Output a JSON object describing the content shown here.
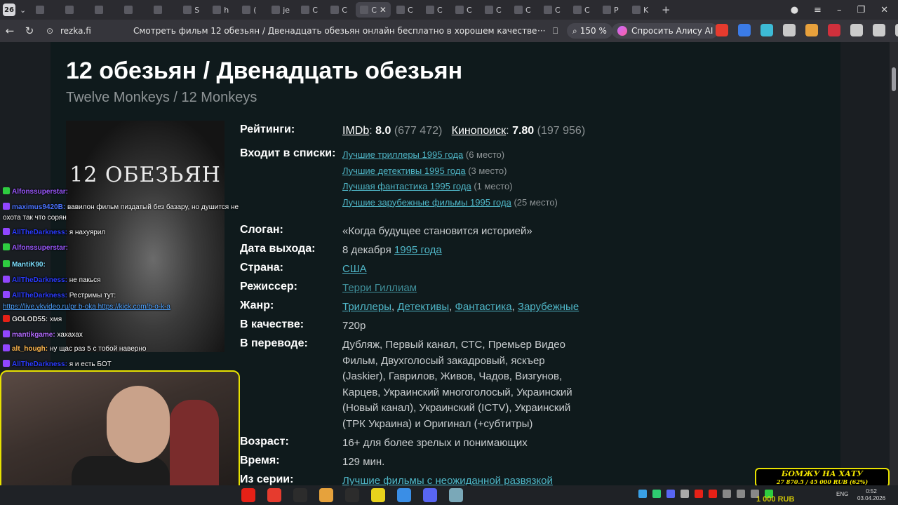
{
  "browser": {
    "tab_count": "26",
    "tabs": [
      {
        "label": "",
        "icon": "youtube-icon"
      },
      {
        "label": "",
        "icon": "gmail-icon"
      },
      {
        "label": "",
        "icon": "home-icon"
      },
      {
        "label": "",
        "icon": "hd-icon"
      },
      {
        "label": "",
        "icon": "hd-icon"
      },
      {
        "label": "S",
        "icon": "steam-icon"
      },
      {
        "label": "h",
        "icon": "news-icon"
      },
      {
        "label": "(",
        "icon": "chat-icon"
      },
      {
        "label": "je",
        "icon": "doc-icon"
      },
      {
        "label": "C",
        "icon": "hd-icon"
      },
      {
        "label": "C",
        "icon": "hd-icon"
      },
      {
        "label": "C",
        "icon": "hd-icon"
      },
      {
        "label": "C",
        "icon": "hd-icon"
      },
      {
        "label": "C",
        "icon": "hd-icon"
      },
      {
        "label": "C",
        "icon": "hd-icon"
      },
      {
        "label": "C",
        "icon": "hd-icon"
      },
      {
        "label": "C",
        "icon": "hd-icon"
      },
      {
        "label": "C",
        "icon": "hd-icon"
      },
      {
        "label": "C",
        "icon": "hd-icon"
      },
      {
        "label": "P",
        "icon": "app-icon"
      },
      {
        "label": "K",
        "icon": "twitch-icon"
      }
    ],
    "active_tab_index": 11,
    "url_domain": "rezka.fi",
    "page_title": "Смотреть фильм 12 обезьян / Двенадцать обезьян онлайн бесплатно в хорошем качестве",
    "zoom": "150 %",
    "alice_label": "Спросить Алису AI",
    "ext_colors": [
      "#e63b2e",
      "#3b7be6",
      "#3dbbd6",
      "#c9c9c9",
      "#e8a13c",
      "#d0303c",
      "#cccccc",
      "#cccccc",
      "#cccccc"
    ]
  },
  "movie": {
    "title": "12 обезьян / Двенадцать обезьян",
    "original_title": "Twelve Monkeys / 12 Monkeys",
    "poster_text": "12 ОБЕЗЬЯН",
    "ratings_label": "Рейтинги:",
    "imdb_name": "IMDb",
    "imdb_score": "8.0",
    "imdb_votes": "(677 472)",
    "kp_name": "Кинопоиск",
    "kp_score": "7.80",
    "kp_votes": "(197 956)",
    "lists_label": "Входит в списки:",
    "lists": [
      {
        "name": "Лучшие триллеры 1995 года",
        "place": "(6 место)"
      },
      {
        "name": "Лучшие детективы 1995 года",
        "place": "(3 место)"
      },
      {
        "name": "Лучшая фантастика 1995 года",
        "place": "(1 место)"
      },
      {
        "name": "Лучшие зарубежные фильмы 1995 года",
        "place": "(25 место)"
      }
    ],
    "slogan_label": "Слоган:",
    "slogan": "«Когда будущее становится историей»",
    "release_label": "Дата выхода:",
    "release_day": "8 декабря",
    "release_year": "1995 года",
    "country_label": "Страна:",
    "country": "США",
    "director_label": "Режиссер:",
    "director": "Терри Гиллиам",
    "genre_label": "Жанр:",
    "genres": [
      "Триллеры",
      "Детективы",
      "Фантастика",
      "Зарубежные"
    ],
    "quality_label": "В качестве:",
    "quality": "720p",
    "translation_label": "В переводе:",
    "translation": "Дубляж, Первый канал, СТС, Премьер Видео Фильм, Двухголосый закадровый, яскъер (Jaskier), Гаврилов, Живов, Чадов, Визгунов, Карцев, Украинский многоголосый, Украинский (Новый канал), Украинский (ICTV), Украинский (ТРК Украина) и Оригинал (+субтитры)",
    "age_label": "Возраст:",
    "age": "16+",
    "age_note": "для более зрелых и понимающих",
    "time_label": "Время:",
    "time": "129 мин.",
    "series_label": "Из серии:",
    "series": "Лучшие фильмы с неожиданной развязкой"
  },
  "chat": [
    {
      "nick": "Alfonssuperstar:",
      "text": "",
      "nick_color": "#9b59ff",
      "badge": "#2ecc40"
    },
    {
      "nick": "maximus9420B:",
      "text": "вавилон фильм пиздатый без базару, но душится не охота так что сорян",
      "nick_color": "#4a73ff",
      "badge": "#9146ff"
    },
    {
      "nick": "AllTheDarkness:",
      "text": "я нахуярил",
      "nick_color": "#2b3cff",
      "badge": "#9146ff"
    },
    {
      "nick": "Alfonssuperstar:",
      "text": "",
      "nick_color": "#9b59ff",
      "badge": "#2ecc40"
    },
    {
      "nick": "MantiK90:",
      "text": "",
      "nick_color": "#7ee0ff",
      "badge": "#2ecc40"
    },
    {
      "nick": "AllTheDarkness:",
      "text": "не пакься",
      "nick_color": "#2b3cff",
      "badge": "#9146ff"
    },
    {
      "nick": "AllTheDarkness:",
      "text": "Рестримы тут:",
      "nick_color": "#2b3cff",
      "badge": "#9146ff"
    },
    {
      "nick": "",
      "text": "https://live.vkvideo.ru/pr b-oka https://kick.com/b-o-k-a",
      "nick_color": "#4fa3ff",
      "badge": ""
    },
    {
      "nick": "GOLOD55:",
      "text": "хмя",
      "nick_color": "#e0e0e0",
      "badge": "#e62117"
    },
    {
      "nick": "mantikgame:",
      "text": "хахахах",
      "nick_color": "#b36bff",
      "badge": "#9146ff"
    },
    {
      "nick": "alt_hough:",
      "text": "ну щас раз 5 с тобой наверно",
      "nick_color": "#ffb84f",
      "badge": "#9146ff"
    },
    {
      "nick": "AllTheDarkness:",
      "text": "я и есть БОТ",
      "nick_color": "#2b3cff",
      "badge": "#9146ff"
    }
  ],
  "donation": {
    "title": "БОМЖУ НА ХАТУ",
    "progress": "27 870.5 / 45 000 RUB (62%)",
    "below": "1 000 RUB"
  },
  "taskbar": {
    "app_colors": [
      "#e62117",
      "#e63b2e",
      "#2c2c2c",
      "#e6a23c",
      "#2c2c2c",
      "#e8d21c",
      "#3a8ee6",
      "#5865f2",
      "#7aa8b8"
    ],
    "lang": "ENG",
    "time": "0:52",
    "date": "03.04.2026"
  }
}
